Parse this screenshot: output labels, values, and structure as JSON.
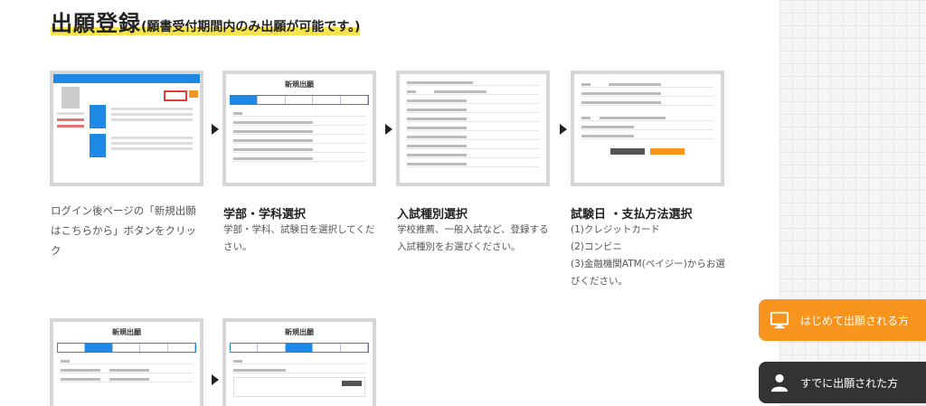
{
  "header": {
    "title_main": "出願登録",
    "title_sub": "(願書受付期間内のみ出願が可能です。)"
  },
  "steps": [
    {
      "title": "",
      "desc": [
        "ログイン後ページの「新規出願",
        "はこちらから」ボタンをクリッ",
        "ク"
      ]
    },
    {
      "title": "学部・学科選択",
      "desc": [
        "学部・学科、試験日を選択してくだ",
        "さい。"
      ]
    },
    {
      "title": "入試種別選択",
      "desc": [
        "学校推薦、一般入試など、登録する",
        "入試種別をお選びください。"
      ]
    },
    {
      "title": "試験日 ・支払方法選択",
      "desc": [
        "(1)クレジットカード",
        "(2)コンビニ",
        "(3)金融機関ATM(ペイジー)からお選",
        "びください。"
      ]
    }
  ],
  "screens": {
    "new_application": "新規出願"
  },
  "side_buttons": {
    "first_time": "はじめて出願される方",
    "already_applied": "すでに出願された方"
  },
  "colors": {
    "orange": "#f7941d",
    "dark": "#333333",
    "highlight": "#f7e34a",
    "blue": "#1e88e5"
  },
  "icons": [
    "monitor-icon",
    "person-icon",
    "arrow-right-icon"
  ]
}
